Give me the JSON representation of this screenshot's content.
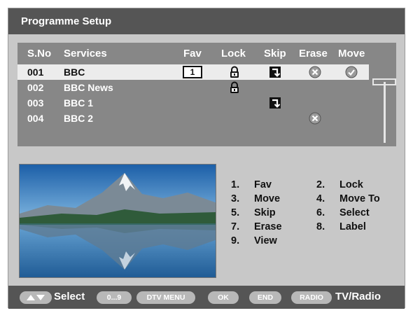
{
  "title": "Programme Setup",
  "columns": {
    "sno": "S.No",
    "services": "Services",
    "fav": "Fav",
    "lock": "Lock",
    "skip": "Skip",
    "erase": "Erase",
    "move": "Move"
  },
  "rows": [
    {
      "no": "001",
      "name": "BBC",
      "fav": "1",
      "lock": true,
      "skip": true,
      "erase": true,
      "move": true,
      "selected": true
    },
    {
      "no": "002",
      "name": "BBC News",
      "fav": "",
      "lock": true,
      "skip": false,
      "erase": false,
      "move": false,
      "selected": false
    },
    {
      "no": "003",
      "name": "BBC 1",
      "fav": "",
      "lock": false,
      "skip": true,
      "erase": false,
      "move": false,
      "selected": false
    },
    {
      "no": "004",
      "name": "BBC 2",
      "fav": "",
      "lock": false,
      "skip": false,
      "erase": true,
      "move": false,
      "selected": false
    }
  ],
  "legend": [
    {
      "num": "1.",
      "label": "Fav"
    },
    {
      "num": "2.",
      "label": "Lock"
    },
    {
      "num": "3.",
      "label": "Move"
    },
    {
      "num": "4.",
      "label": "Move To"
    },
    {
      "num": "5.",
      "label": "Skip"
    },
    {
      "num": "6.",
      "label": "Select"
    },
    {
      "num": "7.",
      "label": "Erase"
    },
    {
      "num": "8.",
      "label": "Label"
    },
    {
      "num": "9.",
      "label": "View"
    }
  ],
  "footer": {
    "arrows_icon": "up-down-arrows-icon",
    "select": "Select",
    "digits": "0...9",
    "dtv_menu": "DTV MENU",
    "ok": "OK",
    "end": "END",
    "radio": "RADIO",
    "tv_radio": "TV/Radio"
  },
  "colors": {
    "panel_dark": "#555555",
    "panel_mid": "#878787",
    "background": "#c8c8c8",
    "selected_row": "#ececec"
  }
}
